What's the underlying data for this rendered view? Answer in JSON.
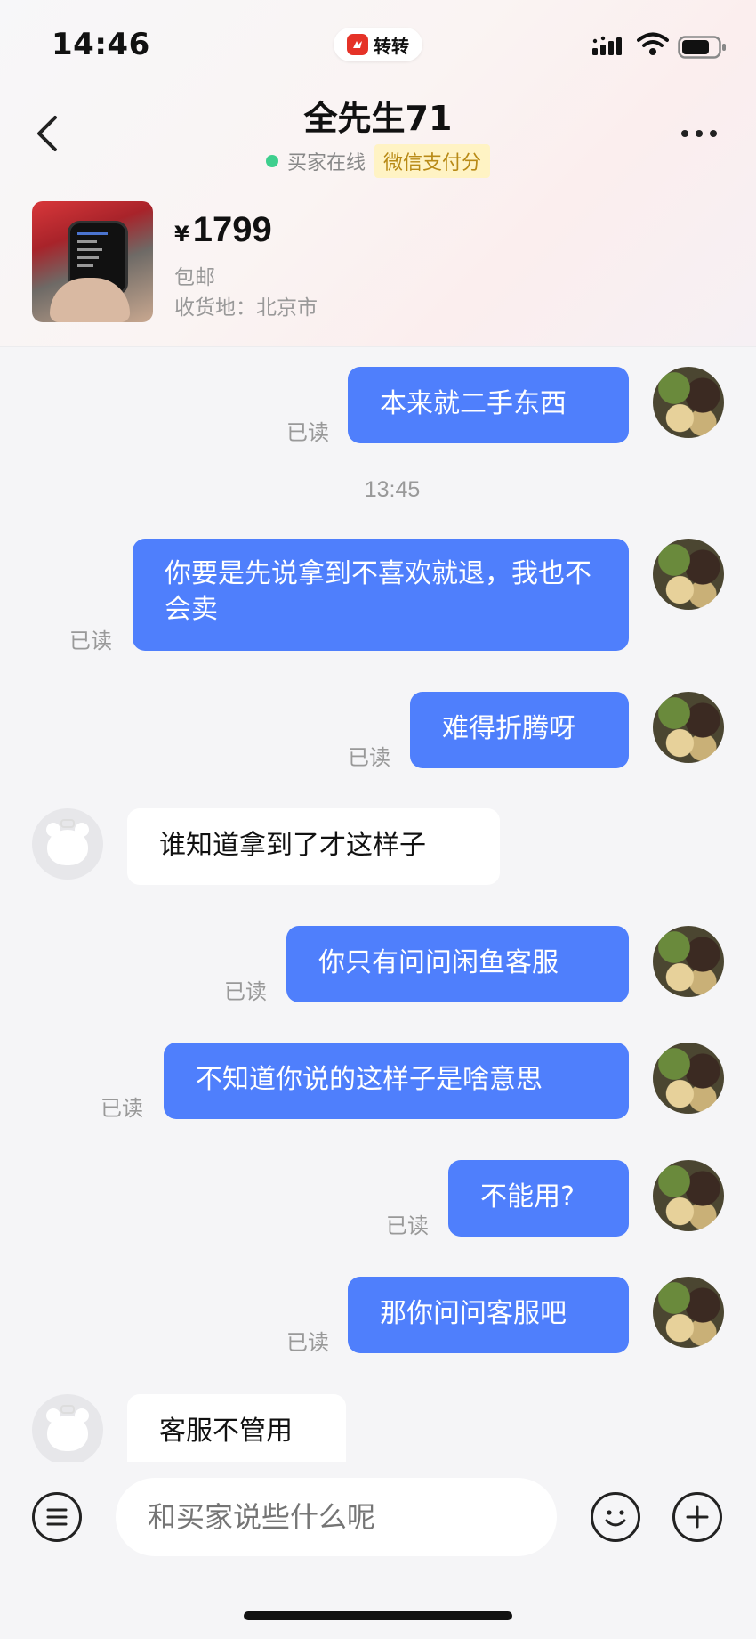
{
  "status_bar": {
    "time": "14:46",
    "app_name": "转转"
  },
  "header": {
    "title": "全先生71",
    "status": "买家在线",
    "badge": "微信支付分"
  },
  "product": {
    "currency": "¥",
    "price": "1799",
    "shipping": "包邮",
    "address": "收货地：北京市"
  },
  "messages": [
    {
      "from": "me",
      "text": "本来就二手东西",
      "read": "已读"
    },
    {
      "timestamp": "13:45"
    },
    {
      "from": "me",
      "text": "你要是先说拿到不喜欢就退，我也不会卖",
      "read": "已读"
    },
    {
      "from": "me",
      "text": "难得折腾呀",
      "read": "已读"
    },
    {
      "from": "other",
      "text": "谁知道拿到了才这样子"
    },
    {
      "from": "me",
      "text": "你只有问问闲鱼客服",
      "read": "已读"
    },
    {
      "from": "me",
      "text": "不知道你说的这样子是啥意思",
      "read": "已读"
    },
    {
      "from": "me",
      "text": "不能用?",
      "read": "已读"
    },
    {
      "from": "me",
      "text": "那你问问客服吧",
      "read": "已读"
    },
    {
      "from": "other",
      "text": "客服不管用"
    }
  ],
  "input": {
    "placeholder": "和买家说些什么呢"
  },
  "icons": {
    "back": "chevron-left-icon",
    "more": "more-icon",
    "menu": "menu-icon",
    "emoji": "emoji-icon",
    "add": "plus-icon"
  },
  "colors": {
    "bubble_out": "#4f7ffc",
    "online": "#3ecf8e",
    "badge_bg": "#fff3c4",
    "brand": "#e53227"
  }
}
